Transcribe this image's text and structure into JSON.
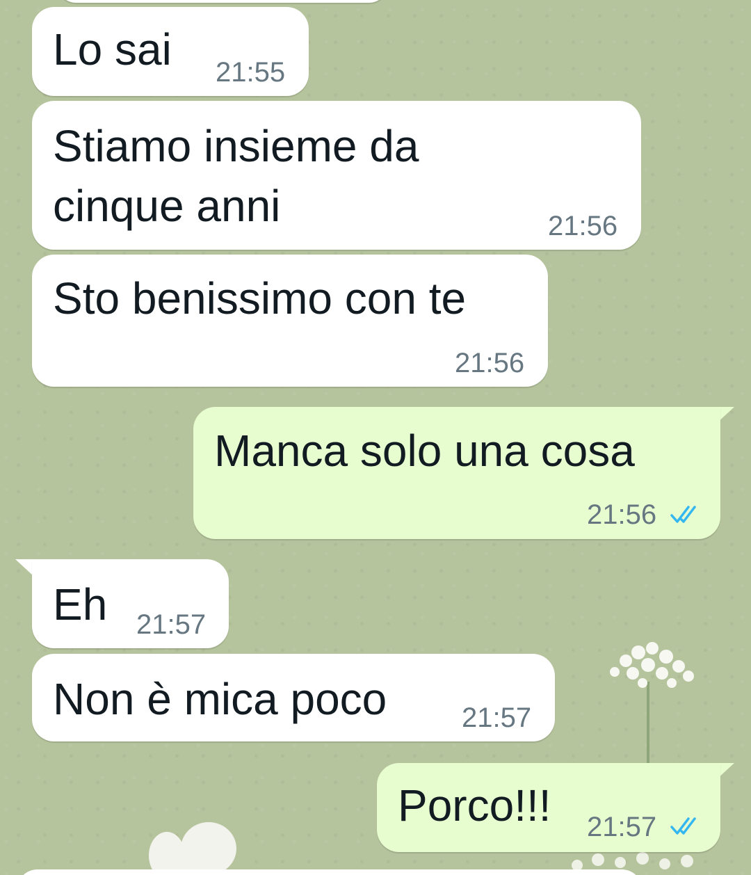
{
  "chat": {
    "messages": [
      {
        "direction": "incoming",
        "text": "Lo sai",
        "time": "21:55"
      },
      {
        "direction": "incoming",
        "text": "Stiamo insieme da",
        "text2": "cinque anni",
        "time": "21:56"
      },
      {
        "direction": "incoming",
        "text": "Sto benissimo con te",
        "time": "21:56"
      },
      {
        "direction": "outgoing",
        "text": "Manca solo una cosa",
        "time": "21:56",
        "status": "read"
      },
      {
        "direction": "incoming",
        "text": "Eh",
        "time": "21:57"
      },
      {
        "direction": "incoming",
        "text": "Non è mica poco",
        "time": "21:57"
      },
      {
        "direction": "outgoing",
        "text": "Porco!!!",
        "time": "21:57",
        "status": "read"
      }
    ]
  },
  "colors": {
    "background": "#b6c49d",
    "incoming_bubble": "#ffffff",
    "outgoing_bubble": "#e7fccf",
    "read_tick": "#34b7f1",
    "timestamp": "#667781"
  },
  "icons": {
    "read_receipt": "double-check-icon"
  }
}
